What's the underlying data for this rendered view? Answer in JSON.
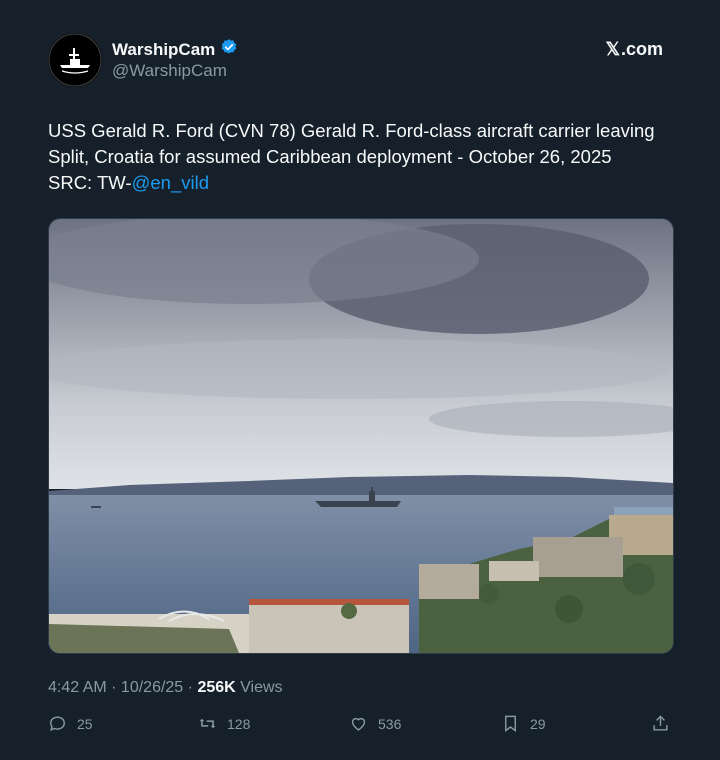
{
  "author": {
    "name": "WarshipCam",
    "handle": "@WarshipCam",
    "verified": true
  },
  "brand": {
    "x_label": "𝕏",
    "domain": ".com"
  },
  "post": {
    "text_main": "USS Gerald R. Ford (CVN 78) Gerald R. Ford-class aircraft carrier leaving Split, Croatia for assumed Caribbean deployment - October 26, 2025",
    "src_prefix": "SRC: TW-",
    "src_link": "@en_vild"
  },
  "meta": {
    "time": "4:42 AM",
    "sep": " · ",
    "date": "10/26/25",
    "views_count": "256K",
    "views_label": "Views"
  },
  "actions": {
    "replies": "25",
    "reposts": "128",
    "likes": "536",
    "bookmarks": "29"
  },
  "colors": {
    "background": "#15202b",
    "link": "#1d9bf0",
    "muted": "#8b98a5",
    "verified": "#1d9bf0"
  },
  "icons": [
    "verified-badge-icon",
    "x-logo-icon",
    "reply-icon",
    "repost-icon",
    "like-icon",
    "bookmark-icon",
    "share-icon"
  ]
}
